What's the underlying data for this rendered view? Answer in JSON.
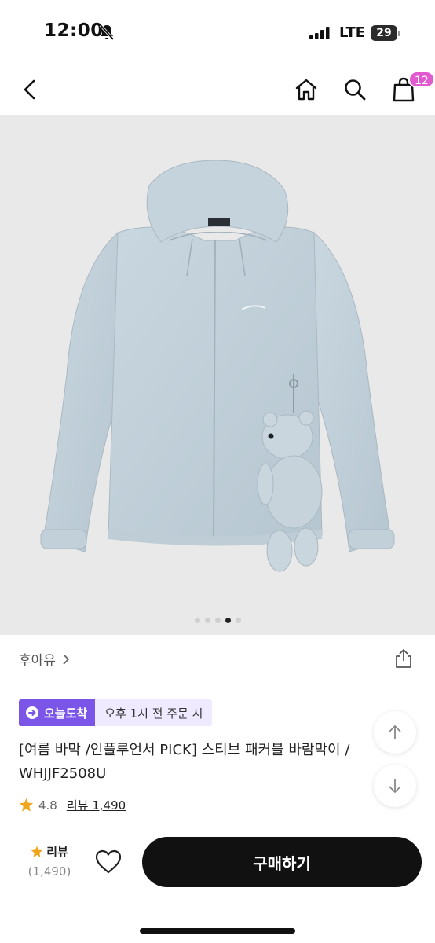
{
  "status_bar": {
    "time": "12:00",
    "network": "LTE",
    "battery": "29",
    "battery_level": 0.29
  },
  "nav": {
    "cart_count": "12"
  },
  "carousel": {
    "total": 5,
    "active_index": 3
  },
  "product": {
    "brand": "후아유",
    "badge_label": "오늘도착",
    "badge_note": "오후 1시 전 주문 시",
    "title": "[여름 바막 /인플루언서 PICK] 스티브 패커블 바람막이 / WHJJF2508U",
    "rating": "4.8",
    "review_link": "리뷰 1,490",
    "colors": {
      "accent": "#7b55e8",
      "badge_bg": "#efeaff",
      "star": "#f0a51c",
      "cart_badge": "#e25ad0"
    }
  },
  "bottom_bar": {
    "review_label": "리뷰",
    "review_count": "(1,490)",
    "buy_label": "구매하기"
  }
}
